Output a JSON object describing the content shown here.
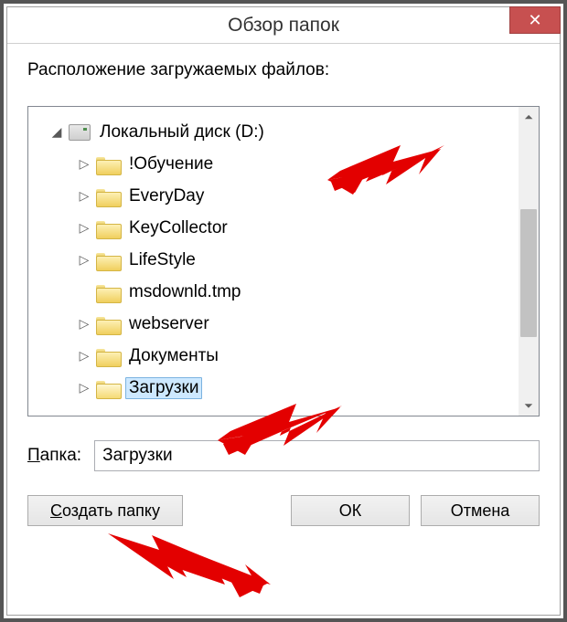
{
  "titlebar": {
    "title": "Обзор папок",
    "close": "✕"
  },
  "prompt": "Расположение загружаемых файлов:",
  "tree": {
    "root": {
      "label": "Локальный диск (D:)",
      "expanded": true
    },
    "items": [
      {
        "label": "!Обучение",
        "expandable": true,
        "selected": false
      },
      {
        "label": "EveryDay",
        "expandable": true,
        "selected": false
      },
      {
        "label": "KeyCollector",
        "expandable": true,
        "selected": false
      },
      {
        "label": "LifeStyle",
        "expandable": true,
        "selected": false
      },
      {
        "label": "msdownld.tmp",
        "expandable": false,
        "selected": false
      },
      {
        "label": "webserver",
        "expandable": true,
        "selected": false
      },
      {
        "label": "Документы",
        "expandable": true,
        "selected": false
      },
      {
        "label": "Загрузки",
        "expandable": true,
        "selected": true
      }
    ]
  },
  "folder_row": {
    "label": "Папка:",
    "value": "Загрузки"
  },
  "buttons": {
    "create": "Создать папку",
    "ok": "ОК",
    "cancel": "Отмена"
  }
}
